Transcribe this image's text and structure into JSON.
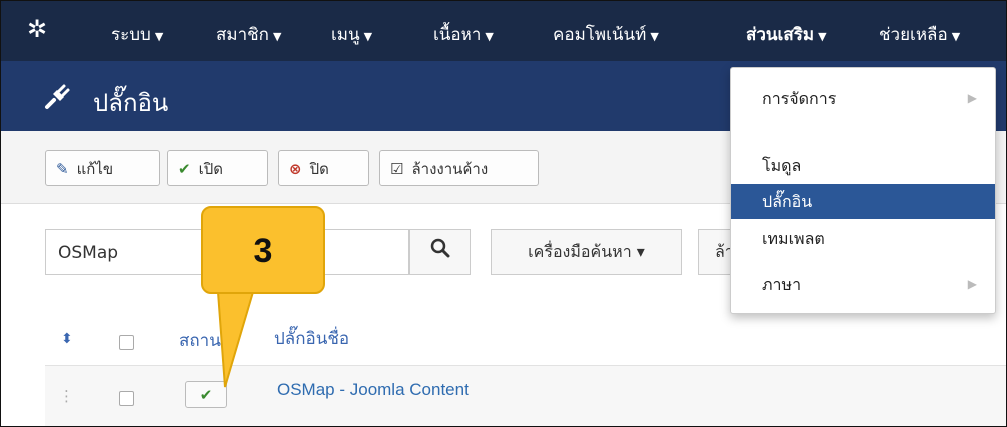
{
  "navbar": {
    "logo_icon": "joomla-logo-icon",
    "caret": "▼",
    "items": [
      {
        "label": "ระบบ"
      },
      {
        "label": "สมาชิก"
      },
      {
        "label": "เมนู"
      },
      {
        "label": "เนื้อหา"
      },
      {
        "label": "คอมโพเน้นท์"
      },
      {
        "label": "ส่วนเสริม"
      },
      {
        "label": "ช่วยเหลือ"
      }
    ],
    "active": "ส่วนเสริม"
  },
  "subhead": {
    "icon": "plug-icon",
    "title": "ปลั๊กอิน"
  },
  "toolbar": {
    "edit_label": "แก้ไข",
    "enable_label": "เปิด",
    "disable_label": "ปิด",
    "checkin_label": "ล้างงานค้าง"
  },
  "search": {
    "value": "OSMap",
    "search_icon": "search-icon",
    "tools_label": "เครื่องมือค้นหา ▾",
    "clear_label": "ล้าง"
  },
  "table": {
    "columns": {
      "status": "สถานะ",
      "name": "ปลั๊กอินชื่อ"
    },
    "rows": [
      {
        "name": "OSMap - Joomla Content",
        "status": "enabled"
      }
    ]
  },
  "dropdown": {
    "items": [
      {
        "label": "การจัดการ",
        "has_submenu": true
      },
      {
        "label": "โมดูล",
        "has_submenu": false
      },
      {
        "label": "ปลั๊กอิน",
        "has_submenu": false,
        "selected": true
      },
      {
        "label": "เทมเพลต",
        "has_submenu": false
      },
      {
        "label": "ภาษา",
        "has_submenu": true
      }
    ]
  },
  "callout": {
    "number": "3",
    "color": "#fbc02d"
  },
  "colors": {
    "navbar": "#1a2a47",
    "subhead": "#213a6c",
    "accent": "#2b5797",
    "link": "#2f6cb0"
  }
}
